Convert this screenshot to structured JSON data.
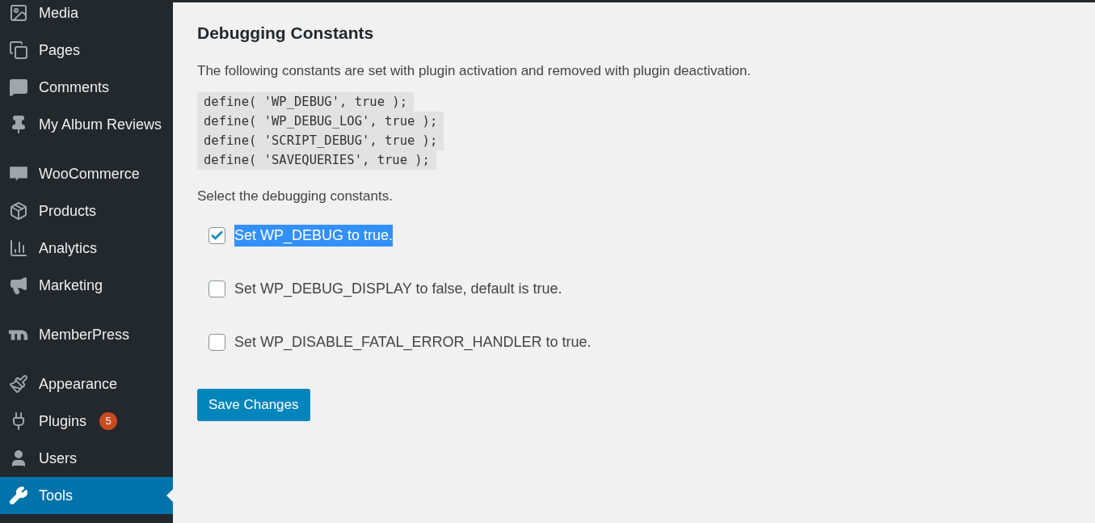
{
  "sidebar": {
    "groups": [
      {
        "items": [
          {
            "kind": "media",
            "label": "Media",
            "selected": false
          },
          {
            "kind": "pages",
            "label": "Pages",
            "selected": false
          },
          {
            "kind": "comments",
            "label": "Comments",
            "selected": false
          },
          {
            "kind": "pin",
            "label": "My Album Reviews",
            "selected": false
          }
        ]
      },
      {
        "items": [
          {
            "kind": "woo",
            "label": "WooCommerce",
            "selected": false
          },
          {
            "kind": "products",
            "label": "Products",
            "selected": false
          },
          {
            "kind": "analytics",
            "label": "Analytics",
            "selected": false
          },
          {
            "kind": "marketing",
            "label": "Marketing",
            "selected": false
          }
        ]
      },
      {
        "items": [
          {
            "kind": "memberpress",
            "label": "MemberPress",
            "selected": false
          }
        ]
      },
      {
        "items": [
          {
            "kind": "appearance",
            "label": "Appearance",
            "selected": false
          },
          {
            "kind": "plugins",
            "label": "Plugins",
            "badge": "5",
            "selected": false
          },
          {
            "kind": "users",
            "label": "Users",
            "selected": false
          },
          {
            "kind": "tools",
            "label": "Tools",
            "selected": true
          }
        ]
      }
    ]
  },
  "main": {
    "heading": "Debugging Constants",
    "description": "The following constants are set with plugin activation and removed with plugin deactivation.",
    "code_lines": [
      "define( 'WP_DEBUG', true );",
      "define( 'WP_DEBUG_LOG', true );",
      "define( 'SCRIPT_DEBUG', true );",
      "define( 'SAVEQUERIES', true );"
    ],
    "select_label": "Select the debugging constants.",
    "options": [
      {
        "label": "Set WP_DEBUG to true.",
        "checked": true,
        "highlighted": true
      },
      {
        "label": "Set WP_DEBUG_DISPLAY to false, default is true.",
        "checked": false,
        "highlighted": false
      },
      {
        "label": "Set WP_DISABLE_FATAL_ERROR_HANDLER to true.",
        "checked": false,
        "highlighted": false
      }
    ],
    "save_button": "Save Changes"
  }
}
